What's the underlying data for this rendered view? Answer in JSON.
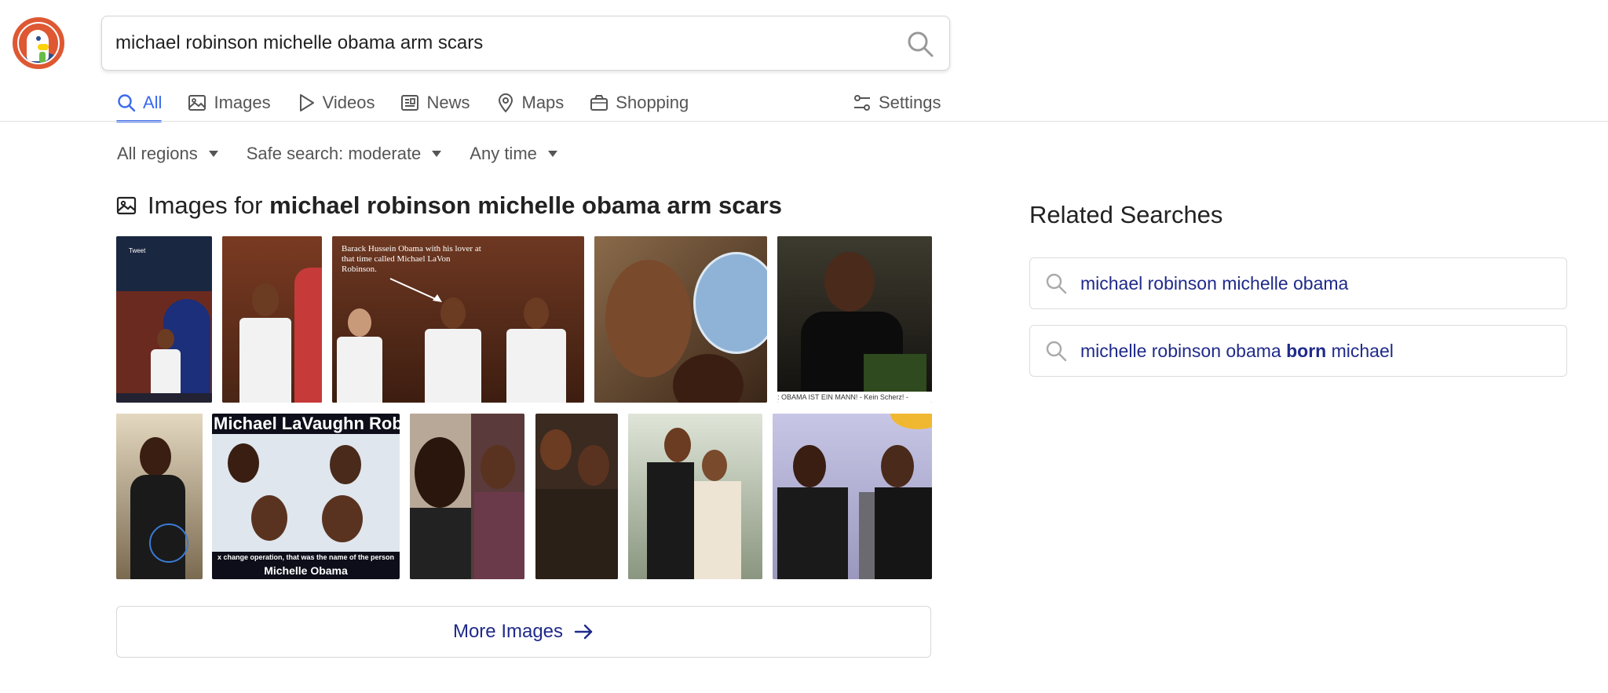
{
  "search": {
    "query": "michael robinson michelle obama arm scars",
    "icon": "search-icon"
  },
  "nav": {
    "tabs": [
      {
        "label": "All",
        "icon": "search-icon",
        "active": true
      },
      {
        "label": "Images",
        "icon": "image-icon"
      },
      {
        "label": "Videos",
        "icon": "play-icon"
      },
      {
        "label": "News",
        "icon": "newspaper-icon"
      },
      {
        "label": "Maps",
        "icon": "map-pin-icon"
      },
      {
        "label": "Shopping",
        "icon": "shopping-bag-icon"
      }
    ],
    "settings_label": "Settings"
  },
  "filters": {
    "region": "All regions",
    "safe_search": "Safe search: moderate",
    "time": "Any time"
  },
  "images_section": {
    "title_prefix": "Images for ",
    "title_query": "michael robinson michelle obama arm scars",
    "thumb_texts": {
      "tweet_header": "Tweet",
      "barack_caption": "Barack Hussein Obama with his lover at that time called Michael LaVon Robinson.",
      "obama_caption": ": OBAMA IST EIN MANN! - Kein Scherz! -",
      "lavaughn_title": "Michael LaVaughn Rob",
      "lavaughn_sub": "x change operation, that was the name of the person",
      "lavaughn_name": "Michelle Obama"
    },
    "more_label": "More Images"
  },
  "related": {
    "title": "Related Searches",
    "items": [
      {
        "prefix": "michael robinson michelle obama",
        "bold": "",
        "suffix": ""
      },
      {
        "prefix": "michelle robinson obama ",
        "bold": "born",
        "suffix": " michael"
      }
    ]
  },
  "colors": {
    "accent": "#3969ef",
    "link": "#1f2a8a",
    "logo": "#de5833"
  }
}
